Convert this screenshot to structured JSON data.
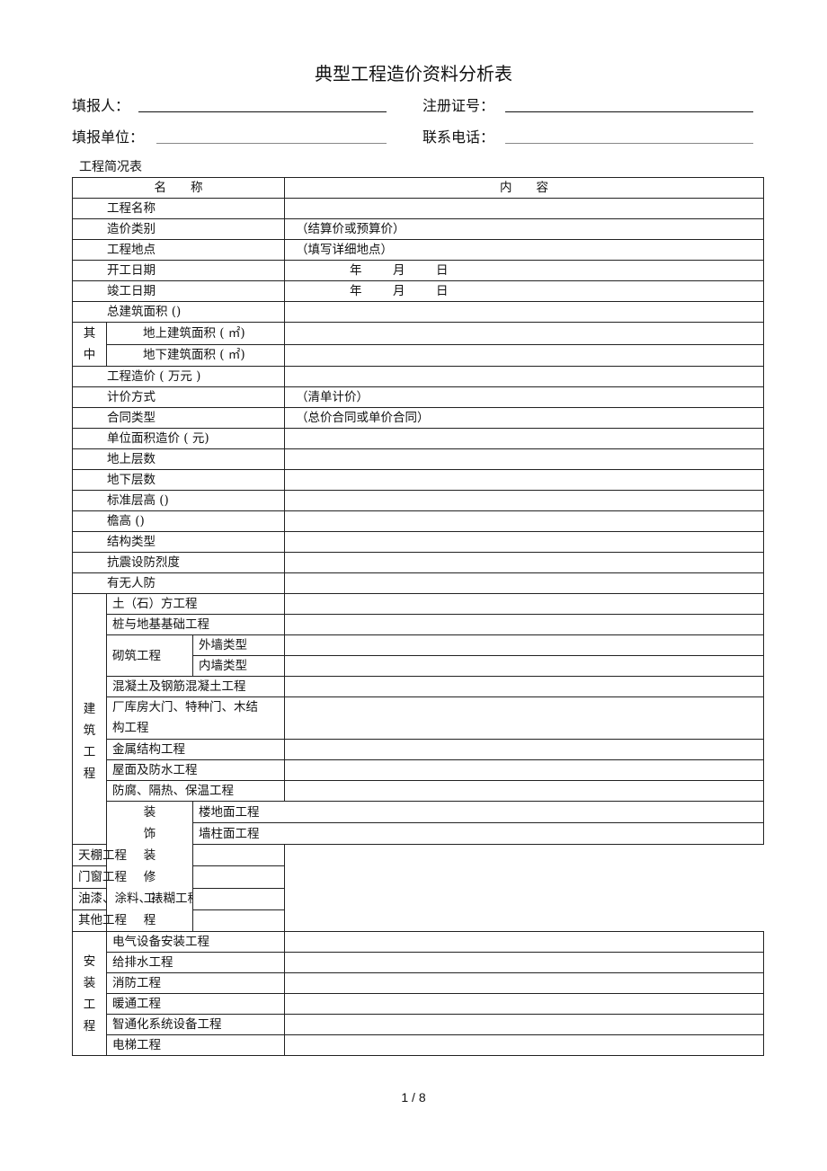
{
  "document": {
    "title": "典型工程造价资料分析表",
    "fields": {
      "filler_label": "填报人：",
      "reg_no_label": "注册证号：",
      "unit_label": "填报单位：",
      "phone_label": "联系电话："
    },
    "subtitle": "工程简况表",
    "table": {
      "header": {
        "name": "名　　称",
        "content": "内　　容"
      },
      "rows": {
        "project_name": {
          "label": "工程名称",
          "value": ""
        },
        "cost_type": {
          "label": "造价类别",
          "value": "（结算价或预算价）"
        },
        "location": {
          "label": "工程地点",
          "value": "（填写详细地点）"
        },
        "start_date": {
          "label": "开工日期",
          "year": "年",
          "month": "月",
          "day": "日"
        },
        "end_date": {
          "label": "竣工日期",
          "year": "年",
          "month": "月",
          "day": "日"
        },
        "total_area": {
          "label": "总建筑面积 ()",
          "value": ""
        },
        "of_which": {
          "group": "其中",
          "above": {
            "label": "地上建筑面积 ( ㎡)",
            "value": ""
          },
          "below": {
            "label": "地下建筑面积 ( ㎡)",
            "value": ""
          }
        },
        "project_cost": {
          "label": "工程造价 ( 万元 )",
          "value": ""
        },
        "pricing_method": {
          "label": "计价方式",
          "value": "（清单计价）"
        },
        "contract_type": {
          "label": "合同类型",
          "value": "（总价合同或单价合同）"
        },
        "unit_cost": {
          "label": "单位面积造价 ( 元)",
          "value": ""
        },
        "floors_above": {
          "label": "地上层数",
          "value": ""
        },
        "floors_below": {
          "label": "地下层数",
          "value": ""
        },
        "std_floor_height": {
          "label": "标准层高 ()",
          "value": ""
        },
        "eave_height": {
          "label": "檐高 ()",
          "value": ""
        },
        "structure_type": {
          "label": "结构类型",
          "value": ""
        },
        "seismic": {
          "label": "抗震设防烈度",
          "value": ""
        },
        "civil_defense": {
          "label": "有无人防",
          "value": ""
        }
      },
      "building": {
        "group": "建筑工程",
        "earthwork": "土（石）方工程",
        "piling": "桩与地基基础工程",
        "masonry": "砌筑工程",
        "outer_wall": "外墙类型",
        "inner_wall": "内墙类型",
        "concrete": "混凝土及钢筋混凝土工程",
        "doors_wood": "厂库房大门、特种门、木结构工程",
        "metal": "金属结构工程",
        "roof": "屋面及防水工程",
        "insulation": "防腐、隔热、保温工程"
      },
      "decoration": {
        "group": "装饰装修工程",
        "items": [
          "楼地面工程",
          "墙柱面工程",
          "天棚工程",
          "门窗工程",
          "油漆、涂料、裱糊工程",
          "其他工程"
        ]
      },
      "installation": {
        "group": "安装工程",
        "items": [
          "电气设备安装工程",
          "给排水工程",
          "消防工程",
          "暖通工程",
          "智通化系统设备工程",
          "电梯工程"
        ]
      }
    },
    "page_number": "1 / 8"
  }
}
